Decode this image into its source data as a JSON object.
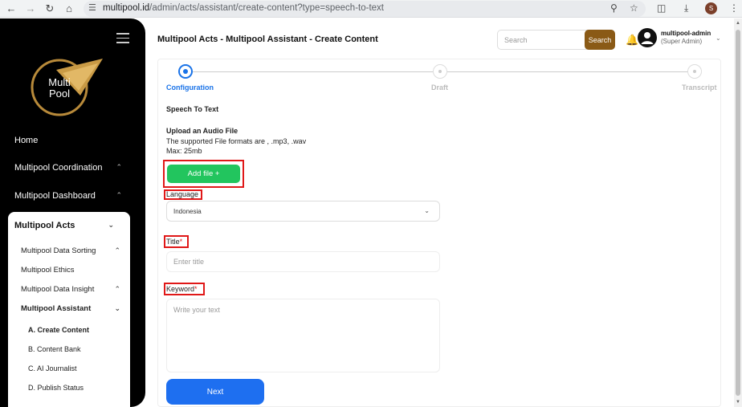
{
  "browser": {
    "url_host": "multipool.id",
    "url_path": "/admin/acts/assistant/create-content?type=speech-to-text",
    "profile_initial": "S"
  },
  "sidebar": {
    "logo_text_1": "Multi",
    "logo_text_2": "Pool",
    "items": [
      {
        "label": "Home"
      },
      {
        "label": "Multipool Coordination"
      },
      {
        "label": "Multipool Dashboard"
      }
    ],
    "acts": {
      "label": "Multipool Acts",
      "children": [
        {
          "label": "Multipool Data Sorting"
        },
        {
          "label": "Multipool Ethics"
        },
        {
          "label": "Multipool Data Insight"
        },
        {
          "label": "Multipool Assistant"
        }
      ],
      "assistant_children": [
        {
          "label": "A. Create Content"
        },
        {
          "label": "B. Content Bank"
        },
        {
          "label": "C. AI Journalist"
        },
        {
          "label": "D. Publish Status"
        }
      ]
    }
  },
  "header": {
    "title": "Multipool Acts - Multipool Assistant - Create Content",
    "search_placeholder": "Search",
    "search_label": "Search",
    "user_name": "multipool-admin",
    "user_role": "(Super Admin)"
  },
  "stepper": {
    "steps": [
      {
        "label": "Configuration"
      },
      {
        "label": "Draft"
      },
      {
        "label": "Transcript"
      }
    ]
  },
  "form": {
    "section_title": "Speech To Text",
    "upload_title": "Upload an Audio File",
    "upload_formats": "The supported File formats are , .mp3, .wav",
    "upload_max": "Max: 25mb",
    "add_file_label": "Add file +",
    "language_label": "Language",
    "language_value": "Indonesia",
    "title_label": "Title",
    "title_placeholder": "Enter title",
    "keyword_label": "Keyword",
    "keyword_placeholder": "Write your text",
    "required_mark": "*",
    "next_label": "Next"
  },
  "colors": {
    "accent_blue": "#1e6ff0",
    "add_green": "#22c55e",
    "search_brown": "#8a5a16",
    "highlight_red": "#e01818"
  }
}
